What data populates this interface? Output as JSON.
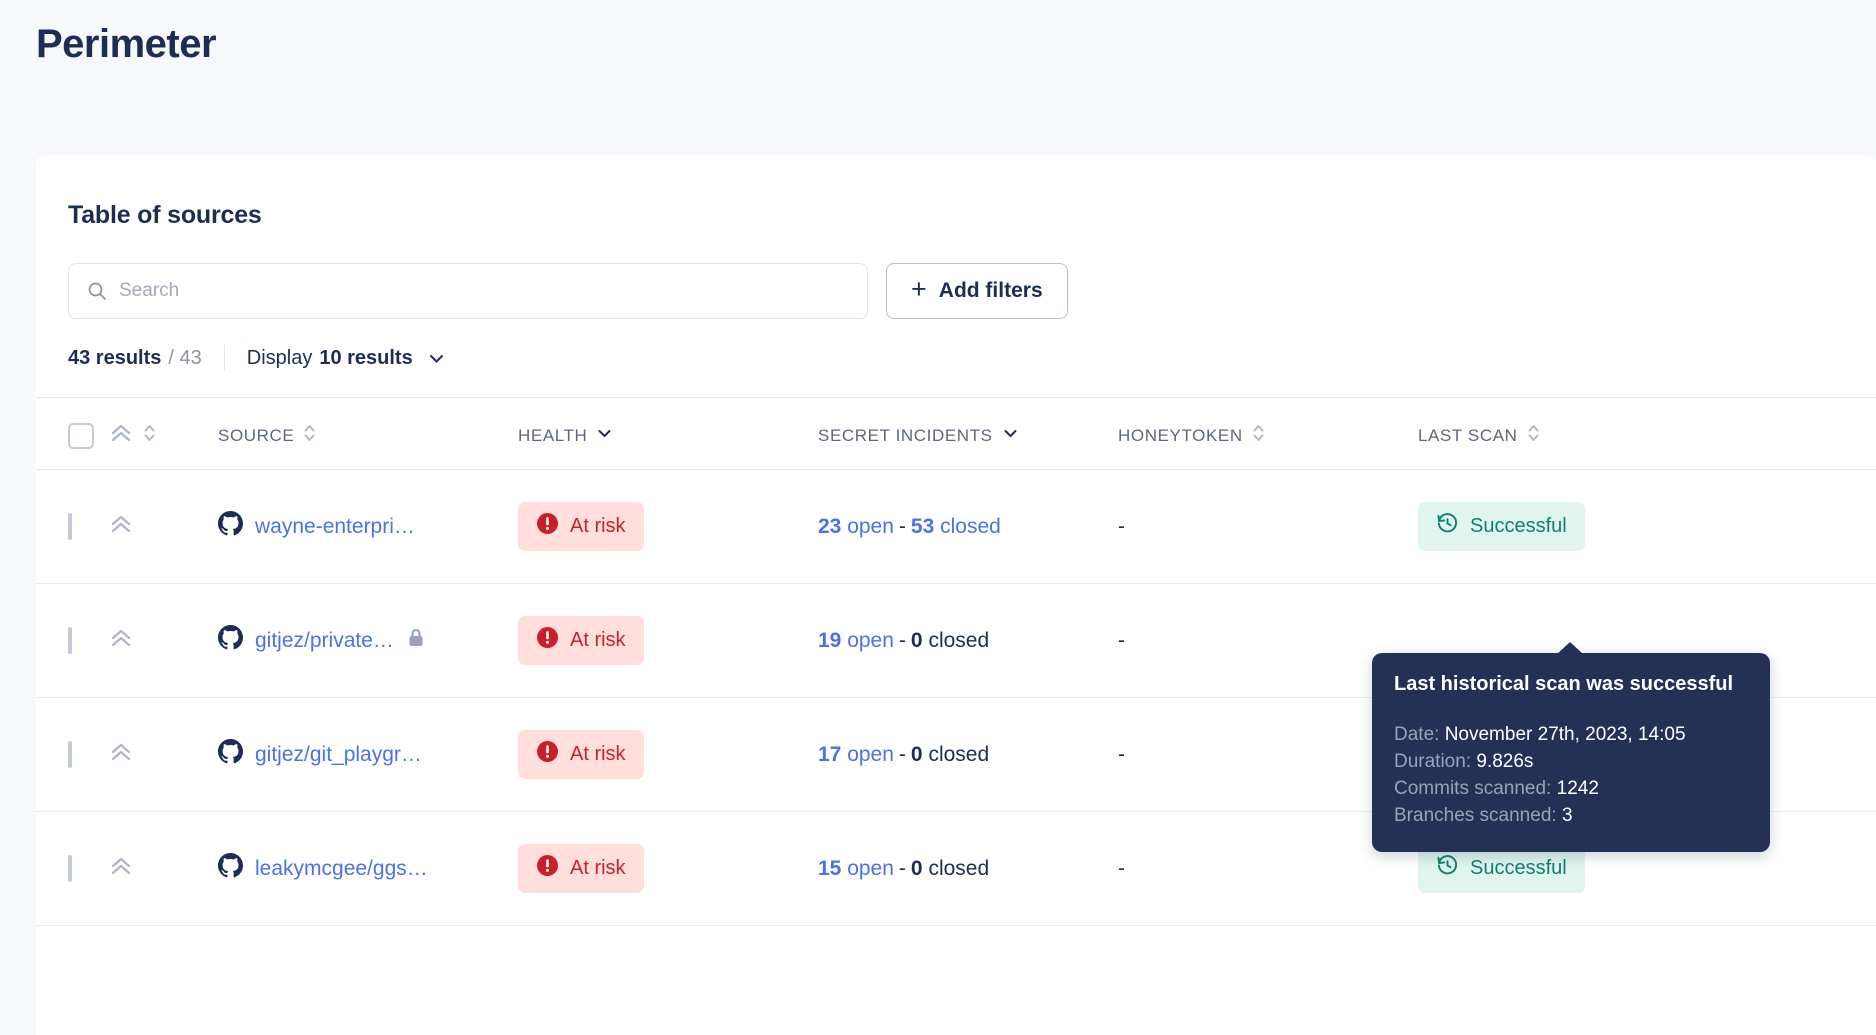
{
  "page": {
    "title": "Perimeter"
  },
  "card": {
    "title": "Table of sources"
  },
  "toolbar": {
    "search_placeholder": "Search",
    "search_value": "",
    "search_icon": "search-icon",
    "add_filters_plus": "+",
    "add_filters_label": "Add filters"
  },
  "results": {
    "count_label": "43 results",
    "total_label": "/ 43",
    "display_label": "Display",
    "display_value": "10 results",
    "chevron_icon": "chevron-down-icon"
  },
  "table": {
    "columns": [
      {
        "key": "checkbox",
        "label": "",
        "sort": "none",
        "icon": "checkbox-icon"
      },
      {
        "key": "severity",
        "label": "",
        "sort": "updown",
        "icon": "double-chevron-up-icon"
      },
      {
        "key": "source",
        "label": "SOURCE",
        "sort": "updown"
      },
      {
        "key": "health",
        "label": "HEALTH",
        "sort": "dropdown"
      },
      {
        "key": "incidents",
        "label": "SECRET INCIDENTS",
        "sort": "dropdown"
      },
      {
        "key": "honeytoken",
        "label": "HONEYTOKEN",
        "sort": "updown"
      },
      {
        "key": "lastscan",
        "label": "LAST SCAN",
        "sort": "updown"
      }
    ],
    "rows": [
      {
        "source": "wayne-enterpri…",
        "source_icon": "github-icon",
        "private": false,
        "health": "At risk",
        "open_count": "23",
        "open_word": "open",
        "separator": "-",
        "closed_count": "53",
        "closed_word": "closed",
        "closed_is_link": true,
        "honeytoken": "-",
        "last_scan": "Successful",
        "last_scan_icon": "history-clock-icon"
      },
      {
        "source": "gitjez/private…",
        "source_icon": "github-icon",
        "private": true,
        "lock_icon": "lock-icon",
        "health": "At risk",
        "open_count": "19",
        "open_word": "open",
        "separator": "-",
        "closed_count": "0",
        "closed_word": "closed",
        "closed_is_link": false,
        "honeytoken": "-",
        "last_scan": "",
        "last_scan_icon": ""
      },
      {
        "source": "gitjez/git_playgr…",
        "source_icon": "github-icon",
        "private": false,
        "health": "At risk",
        "open_count": "17",
        "open_word": "open",
        "separator": "-",
        "closed_count": "0",
        "closed_word": "closed",
        "closed_is_link": false,
        "honeytoken": "-",
        "last_scan": "",
        "last_scan_icon": ""
      },
      {
        "source": "leakymcgee/ggs…",
        "source_icon": "github-icon",
        "private": false,
        "health": "At risk",
        "open_count": "15",
        "open_word": "open",
        "separator": "-",
        "closed_count": "0",
        "closed_word": "closed",
        "closed_is_link": false,
        "honeytoken": "-",
        "last_scan": "Successful",
        "last_scan_icon": "history-clock-icon"
      }
    ]
  },
  "tooltip": {
    "title": "Last historical scan was successful",
    "rows": [
      {
        "label": "Date:",
        "value": "November 27th, 2023, 14:05"
      },
      {
        "label": "Duration:",
        "value": "9.826s"
      },
      {
        "label": "Commits scanned:",
        "value": "1242"
      },
      {
        "label": "Branches scanned:",
        "value": "3"
      }
    ]
  },
  "colors": {
    "page_bg": "#f7f8fb",
    "navy": "#1e2d52",
    "link_blue": "#4a72e8",
    "risk_bg": "#ffdedb",
    "risk_fg": "#c8202a",
    "success_bg": "#dff5ee",
    "success_fg": "#107f72",
    "tooltip_bg": "#243156"
  }
}
